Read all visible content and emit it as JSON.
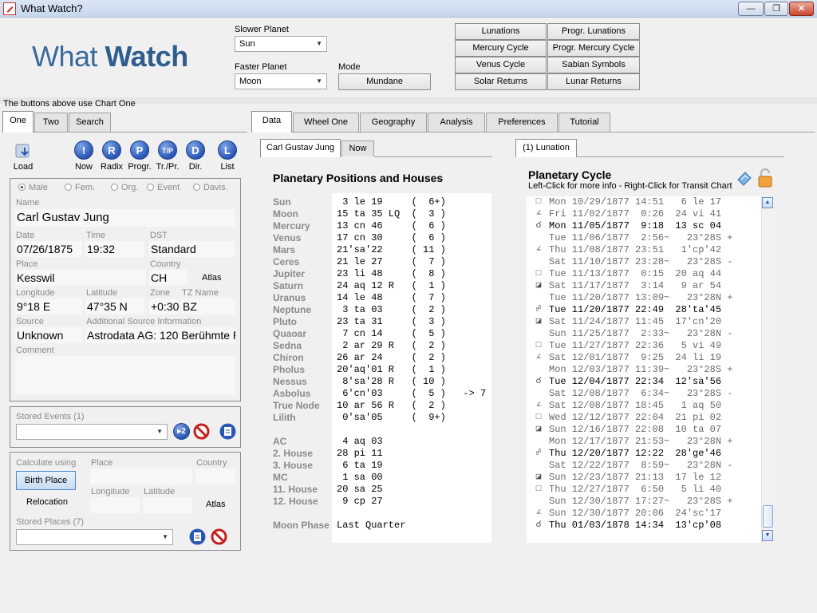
{
  "window": {
    "title": "What Watch?",
    "min": "—",
    "max": "❐",
    "close": "✕"
  },
  "logo": {
    "part1": "What ",
    "part2": "Watch"
  },
  "controls": {
    "slower_label": "Slower Planet",
    "slower_value": "Sun",
    "faster_label": "Faster Planet",
    "faster_value": "Moon",
    "mode_label": "Mode",
    "mode_value": "Mundane"
  },
  "cycle_buttons": [
    "Lunations",
    "Progr. Lunations",
    "Mercury Cycle",
    "Progr. Mercury Cycle",
    "Venus Cycle",
    "Sabian Symbols",
    "Solar Returns",
    "Lunar Returns"
  ],
  "note": "The buttons above use Chart One",
  "left_tabs": [
    "One",
    "Two",
    "Search"
  ],
  "main_tabs": [
    "Data",
    "Wheel One",
    "Geography",
    "Analysis",
    "Preferences",
    "Tutorial"
  ],
  "toolbar": [
    {
      "glyph": "!",
      "label": "Now"
    },
    {
      "glyph": "R",
      "label": "Radix"
    },
    {
      "glyph": "P",
      "label": "Progr."
    },
    {
      "glyph": "T/P",
      "label": "Tr./Pr."
    },
    {
      "glyph": "D",
      "label": "Dir."
    },
    {
      "glyph": "L",
      "label": "List"
    }
  ],
  "load_label": "Load",
  "gender": [
    "Male",
    "Fem.",
    "Org.",
    "Event",
    "Davis."
  ],
  "chart": {
    "name_label": "Name",
    "name": "Carl Gustav Jung",
    "date_label": "Date",
    "date": "07/26/1875",
    "time_label": "Time",
    "time": "19:32",
    "dst_label": "DST",
    "dst": "Standard",
    "place_label": "Place",
    "place": "Kesswil",
    "country_label": "Country",
    "country": "CH",
    "atlas": "Atlas",
    "lon_label": "Longitude",
    "lon": "9°18 E",
    "lat_label": "Latitude",
    "lat": "47°35 N",
    "zone_label": "Zone",
    "zone": "+0:30",
    "tz_label": "TZ Name",
    "tz": "BZ",
    "source_label": "Source",
    "source": "Unknown",
    "addsrc_label": "Additional Source Information",
    "addsrc": "Astrodata AG: 120 Berühmte Pe",
    "comment_label": "Comment"
  },
  "stored_events_label": "Stored Events (1)",
  "calc": {
    "calc_label": "Calculate using",
    "place_label": "Place",
    "country_label": "Country",
    "birth_place": "Birth Place",
    "relocation": "Relocation",
    "lon_label": "Longitude",
    "lat_label": "Latitude",
    "atlas": "Atlas",
    "stored_places_label": "Stored Places (7)"
  },
  "data_subtabs": [
    "Carl Gustav Jung",
    "Now"
  ],
  "positions_title": "Planetary Positions and Houses",
  "positions": [
    {
      "n": "Sun",
      "v": " 3 le 19     (  6+)"
    },
    {
      "n": "Moon",
      "v": "15 ta 35 LQ  (  3 )"
    },
    {
      "n": "Mercury",
      "v": "13 cn 46     (  6 )"
    },
    {
      "n": "Venus",
      "v": "17 cn 30     (  6 )"
    },
    {
      "n": "Mars",
      "v": "21'sa'22     ( 11 )"
    },
    {
      "n": "Ceres",
      "v": "21 le 27     (  7 )"
    },
    {
      "n": "Jupiter",
      "v": "23 li 48     (  8 )"
    },
    {
      "n": "Saturn",
      "v": "24 aq 12 R   (  1 )"
    },
    {
      "n": "Uranus",
      "v": "14 le 48     (  7 )"
    },
    {
      "n": "Neptune",
      "v": " 3 ta 03     (  2 )"
    },
    {
      "n": "Pluto",
      "v": "23 ta 31     (  3 )"
    },
    {
      "n": "Quaoar",
      "v": " 7 cn 14     (  5 )"
    },
    {
      "n": "Sedna",
      "v": " 2 ar 29 R   (  2 )"
    },
    {
      "n": "Chiron",
      "v": "26 ar 24     (  2 )"
    },
    {
      "n": "Pholus",
      "v": "20'aq'01 R   (  1 )"
    },
    {
      "n": "Nessus",
      "v": " 8'sa'28 R   ( 10 )"
    },
    {
      "n": "Asbolus",
      "v": " 6'cn'03     (  5 )   -> 7"
    },
    {
      "n": "True Node",
      "v": "10 ar 56 R   (  2 )"
    },
    {
      "n": "Lilith",
      "v": " 0'sa'05     (  9+)"
    },
    {
      "n": "",
      "v": ""
    },
    {
      "n": "AC",
      "v": " 4 aq 03"
    },
    {
      "n": "2. House",
      "v": "28 pi 11"
    },
    {
      "n": "3. House",
      "v": " 6 ta 19"
    },
    {
      "n": "MC",
      "v": " 1 sa 00"
    },
    {
      "n": "11. House",
      "v": "20 sa 25"
    },
    {
      "n": "12. House",
      "v": " 9 cp 27"
    },
    {
      "n": "",
      "v": ""
    },
    {
      "n": "Moon Phase",
      "v": "Last Quarter"
    }
  ],
  "cycle_tab": "(1) Lunation",
  "cycle_title": "Planetary Cycle",
  "cycle_hint": "Left-Click for more info - Right-Click for Transit Chart",
  "cycle_rows": [
    {
      "s": "□",
      "t": "Mon 10/29/1877 14:51   6 le 17",
      "c": "gray"
    },
    {
      "s": "∠",
      "t": "Fri 11/02/1877  0:26  24 vi 41",
      "c": "gray"
    },
    {
      "s": "☌",
      "t": "Mon 11/05/1877  9:18  13 sc 04",
      "c": "dark"
    },
    {
      "s": "",
      "t": "Tue 11/06/1877  2:56~   23°28S +",
      "c": "gray"
    },
    {
      "s": "∠",
      "t": "Thu 11/08/1877 23:51   1'cp'42",
      "c": "gray"
    },
    {
      "s": "",
      "t": "Sat 11/10/1877 23:28~   23°28S -",
      "c": "gray"
    },
    {
      "s": "□",
      "t": "Tue 11/13/1877  0:15  20 aq 44",
      "c": "gray"
    },
    {
      "s": "◪",
      "t": "Sat 11/17/1877  3:14   9 ar 54",
      "c": "gray"
    },
    {
      "s": "",
      "t": "Tue 11/20/1877 13:09~   23°28N +",
      "c": "gray"
    },
    {
      "s": "☍",
      "t": "Tue 11/20/1877 22:49  28'ta'45",
      "c": "dark"
    },
    {
      "s": "◪",
      "t": "Sat 11/24/1877 11:45  17'cn'20",
      "c": "gray"
    },
    {
      "s": "",
      "t": "Sun 11/25/1877  2:33~   23°28N -",
      "c": "gray"
    },
    {
      "s": "□",
      "t": "Tue 11/27/1877 22:36   5 vi 49",
      "c": "gray"
    },
    {
      "s": "∠",
      "t": "Sat 12/01/1877  9:25  24 li 19",
      "c": "gray"
    },
    {
      "s": "",
      "t": "Mon 12/03/1877 11:39~   23°28S +",
      "c": "gray"
    },
    {
      "s": "☌",
      "t": "Tue 12/04/1877 22:34  12'sa'56",
      "c": "dark"
    },
    {
      "s": "",
      "t": "Sat 12/08/1877  6:34~   23°28S -",
      "c": "gray"
    },
    {
      "s": "∠",
      "t": "Sat 12/08/1877 18:45   1 aq 50",
      "c": "gray"
    },
    {
      "s": "□",
      "t": "Wed 12/12/1877 22:04  21 pi 02",
      "c": "gray"
    },
    {
      "s": "◪",
      "t": "Sun 12/16/1877 22:08  10 ta 07",
      "c": "gray"
    },
    {
      "s": "",
      "t": "Mon 12/17/1877 21:53~   23°28N +",
      "c": "gray"
    },
    {
      "s": "☍",
      "t": "Thu 12/20/1877 12:22  28'ge'46",
      "c": "dark"
    },
    {
      "s": "",
      "t": "Sat 12/22/1877  8:59~   23°28N -",
      "c": "gray"
    },
    {
      "s": "◪",
      "t": "Sun 12/23/1877 21:13  17 le 12",
      "c": "gray"
    },
    {
      "s": "□",
      "t": "Thu 12/27/1877  6:50   5 li 40",
      "c": "gray"
    },
    {
      "s": "",
      "t": "Sun 12/30/1877 17:27~   23°28S +",
      "c": "gray"
    },
    {
      "s": "∠",
      "t": "Sun 12/30/1877 20:06  24'sc'17",
      "c": "gray"
    },
    {
      "s": "☌",
      "t": "Thu 01/03/1878 14:34  13'cp'08",
      "c": "dark"
    }
  ]
}
